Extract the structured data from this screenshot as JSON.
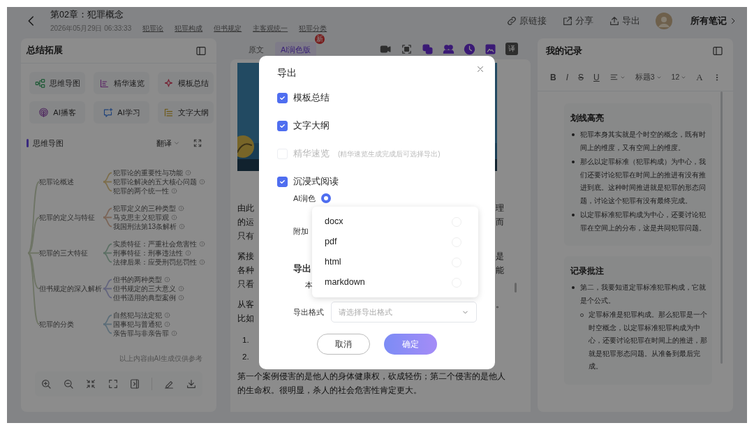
{
  "header": {
    "title": "第02章：犯罪概念",
    "date": "2026年05月29日 06:33:33",
    "tags": [
      "犯罪论",
      "犯罪构成",
      "但书规定",
      "主客观统一",
      "犯罪分类"
    ],
    "actions": [
      {
        "label": "原链接",
        "kind": "link"
      },
      {
        "label": "分享",
        "kind": "share"
      },
      {
        "label": "导出",
        "kind": "export"
      }
    ],
    "notes_link": "所有笔记"
  },
  "left_panel": {
    "title": "总结拓展",
    "tools": [
      {
        "label": "思维导图",
        "kind": "mindmap"
      },
      {
        "label": "精华速览",
        "kind": "digest"
      },
      {
        "label": "模板总结",
        "kind": "template"
      },
      {
        "label": "AI播客",
        "kind": "podcast"
      },
      {
        "label": "AI学习",
        "kind": "study"
      },
      {
        "label": "文字大纲",
        "kind": "outline"
      }
    ],
    "mind_map": {
      "title": "思维导图",
      "translate": "翻译",
      "branches": [
        {
          "label": "犯罪论概述",
          "children": [
            {
              "label": "犯罪论的重要性与功能"
            },
            {
              "label": "犯罪论解决的五大核心问题"
            },
            {
              "label": "犯罪的两个统一性"
            }
          ]
        },
        {
          "label": "犯罪的定义与特征",
          "children": [
            {
              "label": "犯罪定义的三种类型"
            },
            {
              "label": "马克思主义犯罪观"
            },
            {
              "label": "我国刑法第13条解析"
            }
          ]
        },
        {
          "label": "犯罪的三大特征",
          "children": [
            {
              "label": "实质特征：严重社会危害性"
            },
            {
              "label": "刑事特征：刑事违法性"
            },
            {
              "label": "法律后果：应受刑罚惩罚性"
            }
          ]
        },
        {
          "label": "但书规定的深入解析",
          "children": [
            {
              "label": "但书的两种类型"
            },
            {
              "label": "但书规定的三大意义"
            },
            {
              "label": "但书适用的典型案例"
            }
          ]
        },
        {
          "label": "犯罪的分类",
          "children": [
            {
              "label": "自然犯与法定犯"
            },
            {
              "label": "国事犯与普通犯"
            },
            {
              "label": "亲告罪与非亲告罪"
            }
          ]
        }
      ],
      "footnote": "以上内容由AI生成仅供参考"
    }
  },
  "reader": {
    "tabs": [
      {
        "label": "原文",
        "selected": false
      },
      {
        "label": "AI润色版",
        "selected": true,
        "badge": "新"
      }
    ],
    "translate_button": "译",
    "blocks": [
      {
        "kind": "paragraph",
        "lines": [
          {
            "left": "由此",
            "right": "理"
          },
          {
            "left": "的运",
            "right": "而"
          },
          {
            "left": "只有"
          }
        ]
      },
      {
        "kind": "paragraph",
        "lines": [
          {
            "left": "紧接",
            "right": "是"
          },
          {
            "left": "各种",
            "right": "能"
          },
          {
            "left": "只看"
          }
        ]
      },
      {
        "kind": "paragraph",
        "lines": [
          {
            "left": "从客",
            "right": "。"
          },
          {
            "left": "比如"
          }
        ]
      },
      {
        "kind": "list",
        "items": [
          "1.",
          "2."
        ]
      },
      {
        "kind": "paragraph",
        "lines": [
          {
            "left": "第一个案例侵害的是他人的身体健康权，砍成轻伤；第二个侵害的是他人"
          },
          {
            "left": "的生命权。很明显，杀人的社会危害性肯定更大。"
          }
        ]
      }
    ]
  },
  "notes": {
    "title": "我的记录",
    "format_buttons": [
      {
        "label": "B",
        "kind": "bold"
      },
      {
        "label": "I",
        "kind": "italic"
      },
      {
        "label": "S",
        "kind": "strike"
      },
      {
        "label": "U",
        "kind": "underline"
      }
    ],
    "heading": "标题3",
    "size": "12",
    "color_button": "A",
    "sections": [
      {
        "title": "划线高亮",
        "items": [
          {
            "text": "犯罪本身其实就是个时空的概念，既有时间上的维度，又有空间上的维度。"
          },
          {
            "text": "那么以定罪标准（犯罪构成）为中心，我们还要讨论犯罪在时间上的推进有没有推进到底。这种时间推进就是犯罪的形态问题，讨论这个犯罪有没有最终完成。"
          },
          {
            "text": "以定罪标准犯罪构成为中心，还要讨论犯罪在空间上的分布，这是共同犯罪问题。"
          }
        ]
      },
      {
        "title": "记录批注",
        "items": [
          {
            "text": "第二，我要知道定罪标准犯罪构成，它就是个公式。",
            "children": [
              {
                "text": "定罪标准是犯罪构成。那么犯罪是一个时空概念，以定罪标准犯罪构成为中心，还要讨论犯罪在时间上的推进，那就是犯罪形态问题。从准备到最后完成。"
              }
            ]
          }
        ]
      }
    ]
  },
  "export_dialog": {
    "title": "导出",
    "options": [
      {
        "label": "模板总结",
        "checked": true,
        "disabled": false
      },
      {
        "label": "文字大纲",
        "checked": true,
        "disabled": false
      },
      {
        "label": "精华速览",
        "checked": false,
        "disabled": true,
        "hint": "(精华速览生成完成后可选择导出)"
      },
      {
        "label": "沉浸式阅读",
        "checked": true,
        "disabled": false
      }
    ],
    "version_options": [
      {
        "label": "AI润色",
        "selected": true
      }
    ],
    "extra_label": "附加",
    "destination_label": "导出",
    "destination_value": "本",
    "format_label": "导出格式",
    "format_placeholder": "请选择导出格式",
    "format_menu": [
      {
        "label": "docx",
        "selected": false
      },
      {
        "label": "pdf",
        "selected": false
      },
      {
        "label": "html",
        "selected": false
      },
      {
        "label": "markdown",
        "selected": false
      }
    ],
    "buttons": [
      {
        "label": "取消",
        "kind": "secondary"
      },
      {
        "label": "确定",
        "kind": "primary"
      }
    ]
  }
}
